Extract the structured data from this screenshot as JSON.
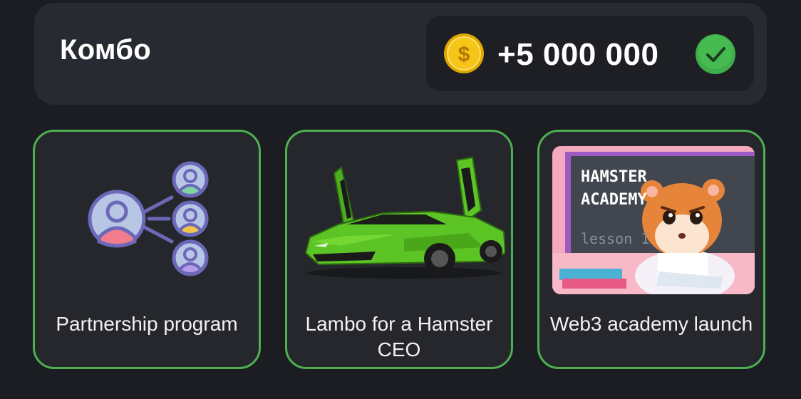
{
  "combo": {
    "title": "Комбо",
    "reward": "+5 000 000",
    "icons": {
      "coin": "dollar-coin-icon",
      "status": "checkmark-icon"
    },
    "colors": {
      "card_border": "#4caf50",
      "check": "#3fae4a",
      "coin": "#f5c518"
    }
  },
  "cards": [
    {
      "label": "Partnership program",
      "image": "partnership-network-icon"
    },
    {
      "label": "Lambo for a Hamster CEO",
      "image": "green-lamborghini-image"
    },
    {
      "label": "Web3 academy launch",
      "image": "hamster-academy-image",
      "image_text": {
        "line1": "HAMSTER",
        "line2": "ACADEMY",
        "line3": "lesson 1"
      }
    }
  ]
}
